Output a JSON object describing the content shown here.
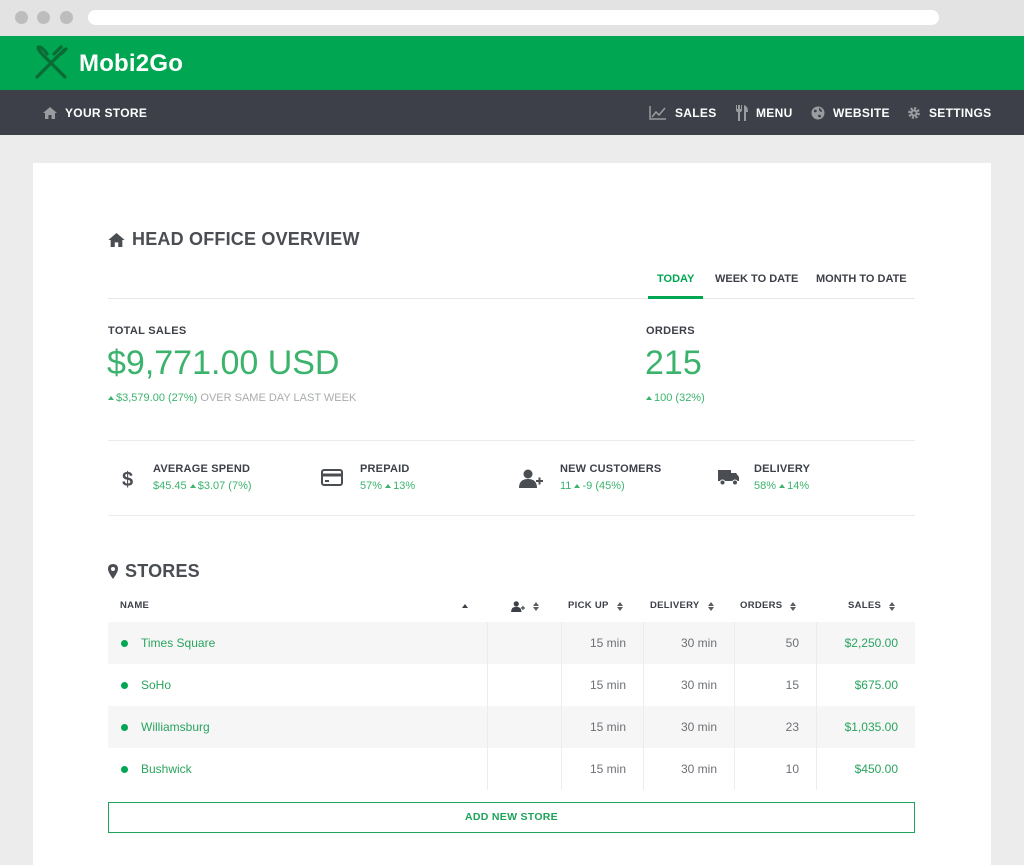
{
  "brand": {
    "name": "Mobi2Go",
    "color": "#00a651"
  },
  "nav": {
    "store": "YOUR STORE",
    "items": [
      {
        "label": "SALES",
        "icon": "chart-line-icon"
      },
      {
        "label": "MENU",
        "icon": "utensils-icon"
      },
      {
        "label": "WEBSITE",
        "icon": "globe-icon"
      },
      {
        "label": "SETTINGS",
        "icon": "gear-icon"
      }
    ]
  },
  "overview": {
    "title": "HEAD OFFICE OVERVIEW",
    "tabs": [
      {
        "label": "TODAY",
        "active": true
      },
      {
        "label": "WEEK TO DATE",
        "active": false
      },
      {
        "label": "MONTH TO DATE",
        "active": false
      }
    ],
    "total_sales": {
      "label": "TOTAL SALES",
      "value": "$9,771.00 USD",
      "change": "$3,579.00 (27%)",
      "note": "OVER SAME DAY LAST WEEK"
    },
    "orders": {
      "label": "ORDERS",
      "value": "215",
      "change": "100 (32%)"
    },
    "metrics": [
      {
        "label": "AVERAGE SPEND",
        "value": "$45.45",
        "change": "$3.07 (7%)",
        "icon": "dollar-icon"
      },
      {
        "label": "PREPAID",
        "value": "57%",
        "change": "13%",
        "icon": "credit-card-icon"
      },
      {
        "label": "NEW CUSTOMERS",
        "value": "11",
        "change": "-9 (45%)",
        "icon": "user-plus-icon"
      },
      {
        "label": "DELIVERY",
        "value": "58%",
        "change": "14%",
        "icon": "truck-icon"
      }
    ]
  },
  "stores": {
    "title": "STORES",
    "columns": {
      "name": "NAME",
      "pickup": "PICK UP",
      "delivery": "DELIVERY",
      "orders": "ORDERS",
      "sales": "SALES"
    },
    "rows": [
      {
        "name": "Times Square",
        "pickup": "15 min",
        "delivery": "30 min",
        "orders": "50",
        "sales": "$2,250.00"
      },
      {
        "name": "SoHo",
        "pickup": "15 min",
        "delivery": "30 min",
        "orders": "15",
        "sales": "$675.00"
      },
      {
        "name": "Williamsburg",
        "pickup": "15 min",
        "delivery": "30 min",
        "orders": "23",
        "sales": "$1,035.00"
      },
      {
        "name": "Bushwick",
        "pickup": "15 min",
        "delivery": "30 min",
        "orders": "10",
        "sales": "$450.00"
      }
    ],
    "add_button": "ADD NEW STORE"
  }
}
